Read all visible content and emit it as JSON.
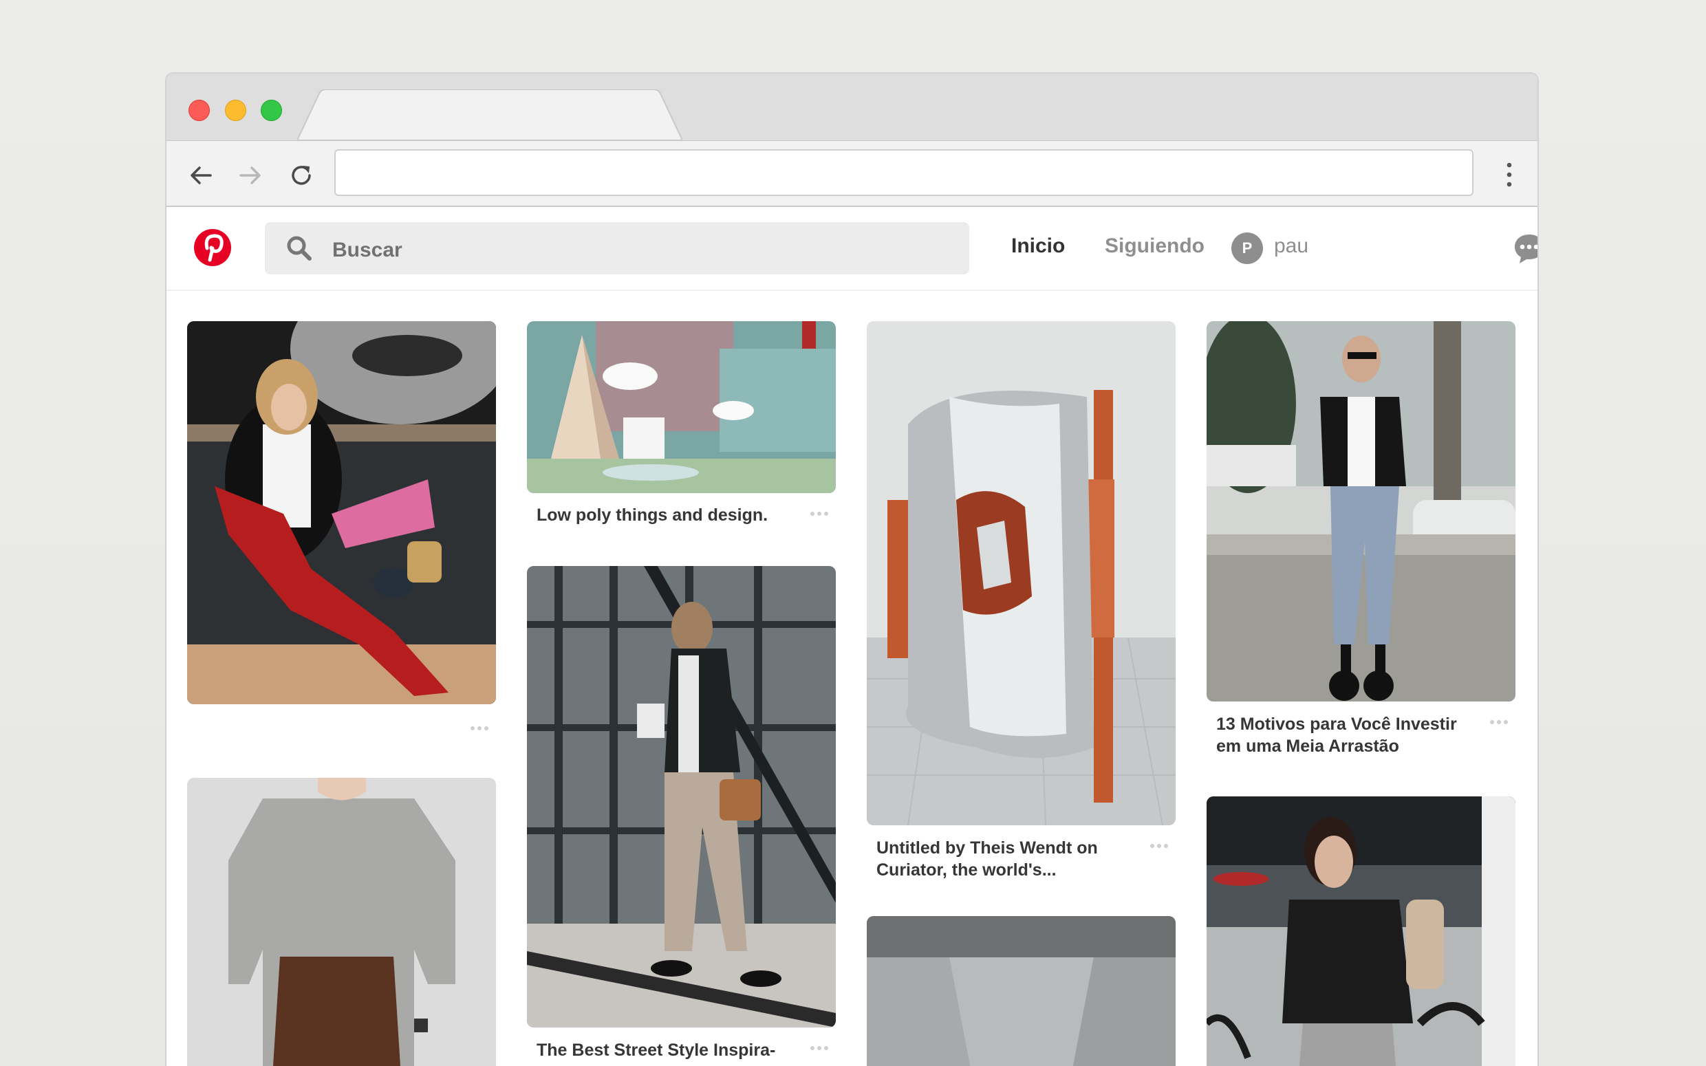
{
  "browser": {
    "url": "",
    "tab_title": ""
  },
  "header": {
    "search_placeholder": "Buscar",
    "nav_home": "Inicio",
    "nav_following": "Siguiendo",
    "avatar_initial": "P",
    "username": "pau"
  },
  "pins": [
    {
      "caption": ""
    },
    {
      "caption": "Low poly things and design."
    },
    {
      "caption": "Untitled by Theis Wendt on Curiator, the world's..."
    },
    {
      "caption": "13 Motivos para Você Investir em uma Meia Arrastão"
    },
    {
      "caption": ""
    },
    {
      "caption": "The Best Street Style Inspira-"
    },
    {
      "caption": ""
    },
    {
      "caption": ""
    }
  ],
  "colors": {
    "brand": "#e60023",
    "close": "#fc5b57",
    "minimize": "#fdbc2e",
    "maximize": "#33c748"
  }
}
